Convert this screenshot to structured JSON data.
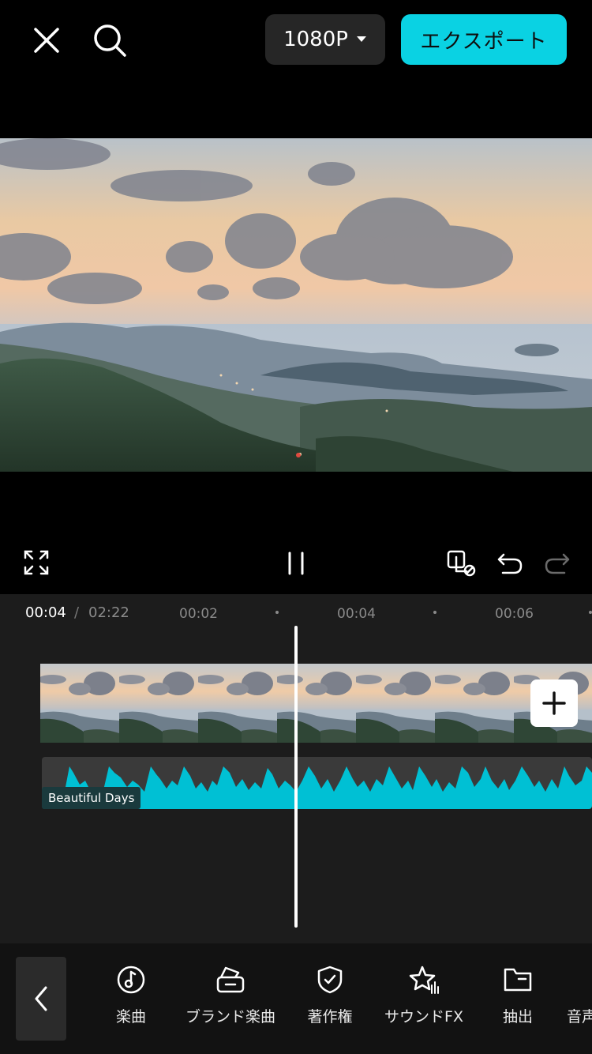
{
  "header": {
    "resolution_label": "1080P",
    "export_label": "エクスポート"
  },
  "timeline": {
    "current_time": "00:04",
    "separator": "/",
    "total_time": "02:22",
    "ticks": [
      "00:02",
      "00:04",
      "00:06"
    ],
    "audio_track_name": "Beautiful Days"
  },
  "toolbar": {
    "items": [
      {
        "label": "楽曲",
        "icon": "music-note-icon"
      },
      {
        "label": "ブランド楽曲",
        "icon": "brand-music-icon"
      },
      {
        "label": "著作権",
        "icon": "shield-check-icon"
      },
      {
        "label": "サウンドFX",
        "icon": "sound-fx-star-icon"
      },
      {
        "label": "抽出",
        "icon": "folder-icon"
      },
      {
        "label": "音声",
        "icon": "voice-icon"
      }
    ]
  },
  "colors": {
    "accent": "#0ad2e3",
    "waveform": "#00c0d4",
    "background": "#000000",
    "timeline_bg": "#1c1c1c"
  }
}
